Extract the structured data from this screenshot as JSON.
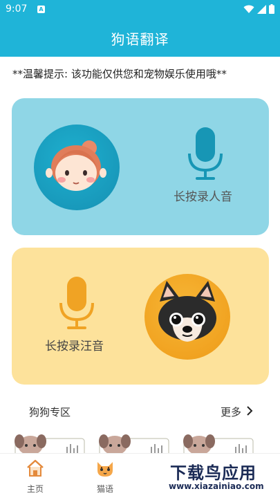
{
  "status_bar": {
    "time": "9:07",
    "notification_badge": "A"
  },
  "app_bar": {
    "title": "狗语翻译"
  },
  "tip": {
    "text": "**温馨提示: 该功能仅供您和宠物娱乐使用哦**"
  },
  "human_card": {
    "label": "长按录人音",
    "avatar_icon": "girl-face-icon",
    "mic_icon": "microphone-icon",
    "color": "#8fd6e6"
  },
  "dog_card": {
    "label": "长按录汪音",
    "avatar_icon": "dog-face-icon",
    "mic_icon": "microphone-icon",
    "color": "#fde29b"
  },
  "section": {
    "title": "狗狗专区",
    "more": "更多"
  },
  "bottom_nav": {
    "items": [
      {
        "label": "主页",
        "icon": "home-icon"
      },
      {
        "label": "猫语",
        "icon": "cat-face-icon"
      }
    ]
  },
  "watermark": {
    "title": "下载鸟应用",
    "url": "www.xiazainiao.com"
  },
  "colors": {
    "primary": "#1fb4d8",
    "mic_blue": "#1796b5",
    "mic_orange": "#f0a324"
  }
}
